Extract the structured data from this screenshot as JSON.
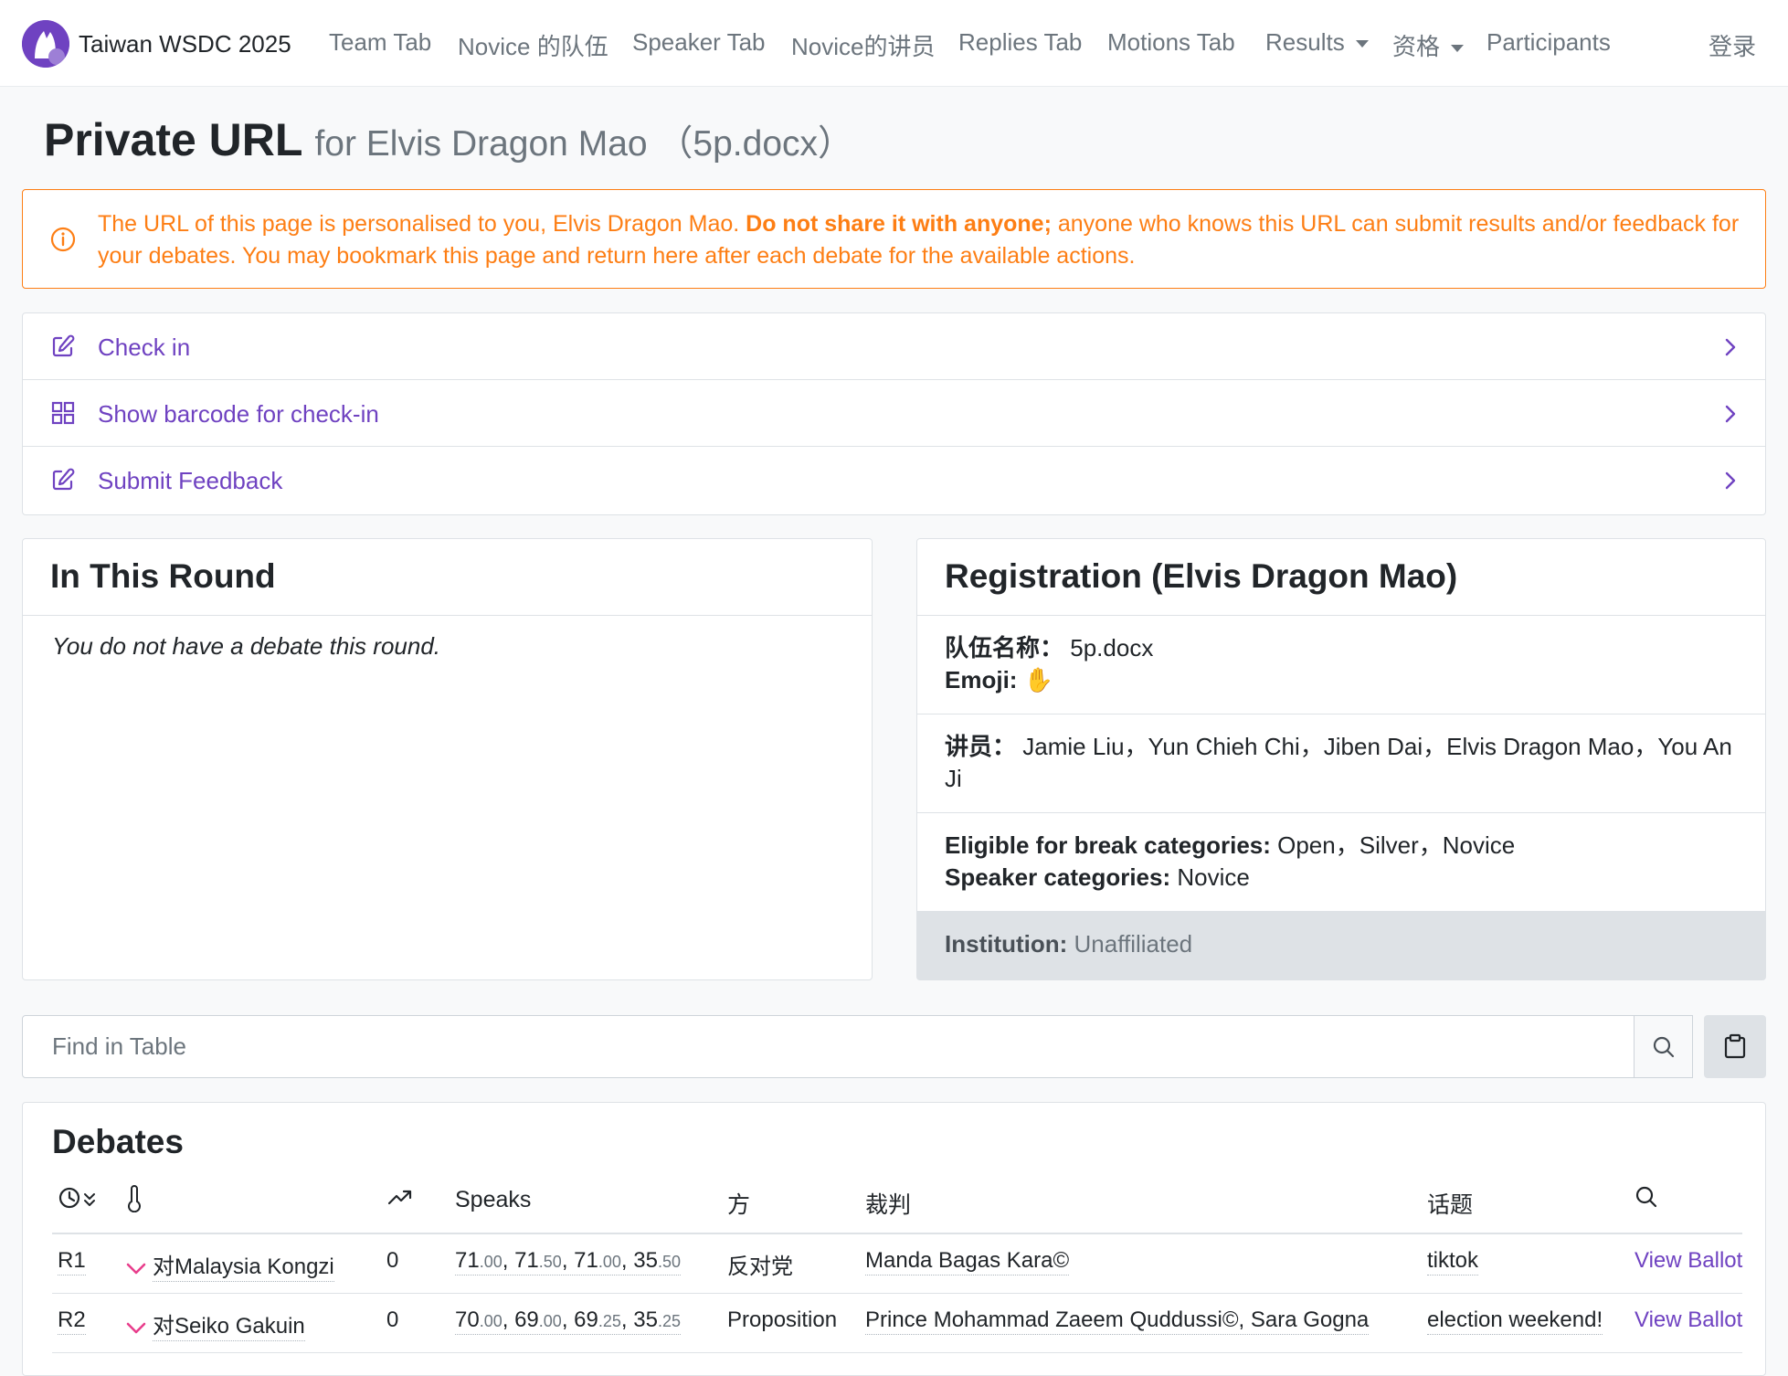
{
  "nav": {
    "brand": "Taiwan WSDC 2025",
    "items": [
      "Team Tab",
      "Novice 的队伍",
      "Speaker Tab",
      "Novice的讲员",
      "Replies Tab",
      "Motions Tab",
      "Results",
      "资格",
      "Participants"
    ],
    "login": "登录"
  },
  "page": {
    "title": "Private URL",
    "subtitle": "for Elvis Dragon Mao （5p.docx）"
  },
  "alert": {
    "part1": "The URL of this page is personalised to you, Elvis Dragon Mao. ",
    "bold": "Do not share it with anyone;",
    "part2": " anyone who knows this URL can submit results and/or feedback for your debates. You may bookmark this page and return here after each debate for the available actions."
  },
  "actions": [
    {
      "label": "Check in",
      "icon": "edit-icon"
    },
    {
      "label": "Show barcode for check-in",
      "icon": "grid-icon"
    },
    {
      "label": "Submit Feedback",
      "icon": "edit-icon"
    }
  ],
  "round": {
    "title": "In This Round",
    "message": "You do not have a debate this round."
  },
  "registration": {
    "title": "Registration (Elvis Dragon Mao)",
    "team_label": "队伍名称：",
    "team_value": "5p.docx",
    "emoji_label": "Emoji:",
    "emoji_value": "✋",
    "speakers_label": "讲员：",
    "speakers_value": "Jamie Liu，Yun Chieh Chi，Jiben Dai，Elvis Dragon Mao，You An Ji",
    "break_label": "Eligible for break categories:",
    "break_value": "Open，Silver，Novice",
    "speaker_cat_label": "Speaker categories:",
    "speaker_cat_value": "Novice",
    "institution_label": "Institution:",
    "institution_value": "Unaffiliated"
  },
  "search": {
    "placeholder": "Find in Table"
  },
  "debates": {
    "title": "Debates",
    "headers": {
      "round_icon": "clock-sort-icon",
      "result_icon": "thermometer-icon",
      "points_icon": "trend-icon",
      "speaks": "Speaks",
      "side": "方",
      "adjudicators": "裁判",
      "motion": "话题",
      "ballot_icon": "search-icon"
    },
    "rows": [
      {
        "round": "R1",
        "opponent": "对Malaysia Kongzi",
        "points": "0",
        "speaks": [
          [
            "71",
            ".00"
          ],
          [
            "71",
            ".50"
          ],
          [
            "71",
            ".00"
          ],
          [
            "35",
            ".50"
          ]
        ],
        "side": "反对党",
        "adjudicators": "Manda Bagas Kara©",
        "motion": "tiktok",
        "ballot": "View Ballot"
      },
      {
        "round": "R2",
        "opponent": "对Seiko Gakuin",
        "points": "0",
        "speaks": [
          [
            "70",
            ".00"
          ],
          [
            "69",
            ".00"
          ],
          [
            "69",
            ".25"
          ],
          [
            "35",
            ".25"
          ]
        ],
        "side": "Proposition",
        "adjudicators": "Prince Mohammad Zaeem Quddussi©, Sara Gogna",
        "motion": "election weekend!",
        "ballot": "View Ballot"
      }
    ]
  },
  "colors": {
    "primary": "#6f42c1",
    "warning": "#fd7e14",
    "loss": "#e83e8c"
  }
}
